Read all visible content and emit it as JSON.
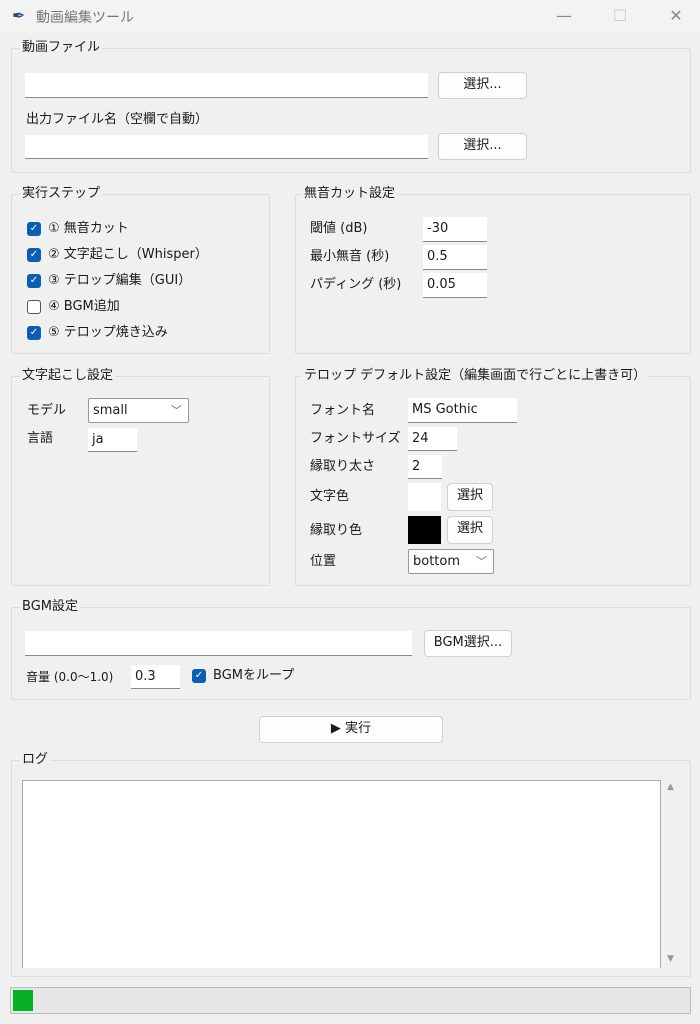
{
  "window": {
    "title": "動画編集ツール",
    "minimize": "—",
    "maximize": "☐",
    "close": "✕"
  },
  "video": {
    "title": "動画ファイル",
    "input_value": "",
    "select": "選択...",
    "output_label": "出力ファイル名（空欄で自動）",
    "output_value": "",
    "output_select": "選択..."
  },
  "steps": {
    "title": "実行ステップ",
    "items": [
      {
        "label": "① 無音カット",
        "checked": true
      },
      {
        "label": "② 文字起こし（Whisper）",
        "checked": true
      },
      {
        "label": "③ テロップ編集（GUI）",
        "checked": true
      },
      {
        "label": "④ BGM追加",
        "checked": false
      },
      {
        "label": "⑤ テロップ焼き込み",
        "checked": true
      }
    ]
  },
  "silence": {
    "title": "無音カット設定",
    "threshold_label": "閾値 (dB)",
    "threshold": "-30",
    "min_label": "最小無音 (秒)",
    "min": "0.5",
    "padding_label": "パディング (秒)",
    "padding": "0.05"
  },
  "transcribe": {
    "title": "文字起こし設定",
    "model_label": "モデル",
    "model": "small",
    "lang_label": "言語",
    "lang": "ja"
  },
  "telop": {
    "title": "テロップ デフォルト設定（編集画面で行ごとに上書き可）",
    "font_label": "フォント名",
    "font": "MS Gothic",
    "size_label": "フォントサイズ",
    "size": "24",
    "outline_label": "縁取り太さ",
    "outline": "2",
    "color_label": "文字色",
    "color": "#ffffff",
    "color_btn": "選択",
    "ocolor_label": "縁取り色",
    "ocolor": "#000000",
    "ocolor_btn": "選択",
    "pos_label": "位置",
    "pos": "bottom"
  },
  "bgm": {
    "title": "BGM設定",
    "path": "",
    "select": "BGM選択...",
    "volume_label": "音量 (0.0〜1.0)",
    "volume": "0.3",
    "loop_label": "BGMをループ",
    "loop": true
  },
  "run": {
    "label": "▶ 実行"
  },
  "log": {
    "title": "ログ",
    "content": ""
  },
  "progress": {
    "value": 0.03,
    "color": "#06b025"
  }
}
